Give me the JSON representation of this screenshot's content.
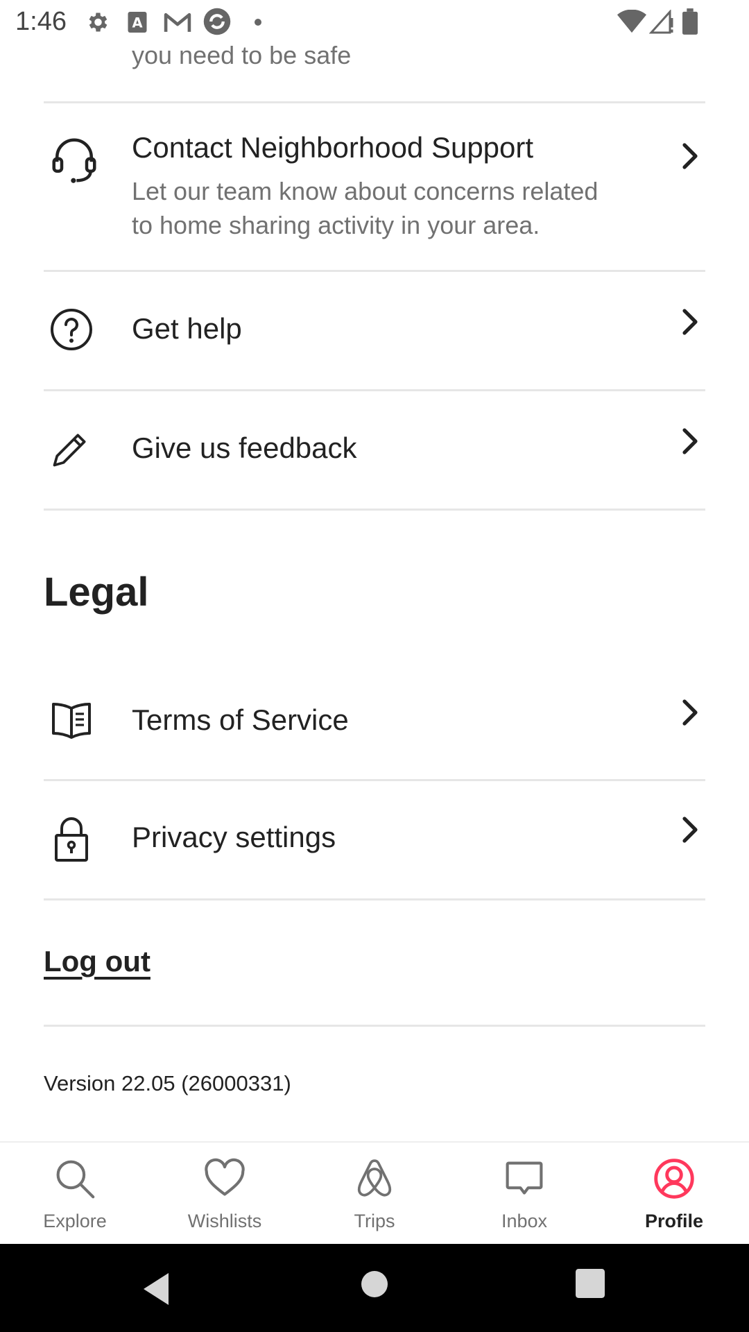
{
  "status_bar": {
    "time": "1:46"
  },
  "content": {
    "cut_off_text": "you need to be safe",
    "rows": [
      {
        "title": "Contact Neighborhood Support",
        "subtitle_line1": "Let our team know about concerns related",
        "subtitle_line2": "to home sharing activity in your area.",
        "icon": "headset-icon"
      },
      {
        "title": "Get help",
        "icon": "question-circle-icon"
      },
      {
        "title": "Give us feedback",
        "icon": "pencil-icon"
      }
    ],
    "legal_heading": "Legal",
    "legal_rows": [
      {
        "title": "Terms of Service",
        "icon": "book-icon"
      },
      {
        "title": "Privacy settings",
        "icon": "lock-icon"
      }
    ],
    "logout_label": "Log out",
    "version": "Version 22.05 (26000331)"
  },
  "tabs": [
    {
      "label": "Explore",
      "icon": "search-icon"
    },
    {
      "label": "Wishlists",
      "icon": "heart-icon"
    },
    {
      "label": "Trips",
      "icon": "airbnb-logo-icon"
    },
    {
      "label": "Inbox",
      "icon": "message-icon"
    },
    {
      "label": "Profile",
      "icon": "profile-icon",
      "active": true
    }
  ],
  "colors": {
    "accent": "#ff385c",
    "text": "#222222",
    "muted": "#717171",
    "divider": "#e6e6e6"
  }
}
